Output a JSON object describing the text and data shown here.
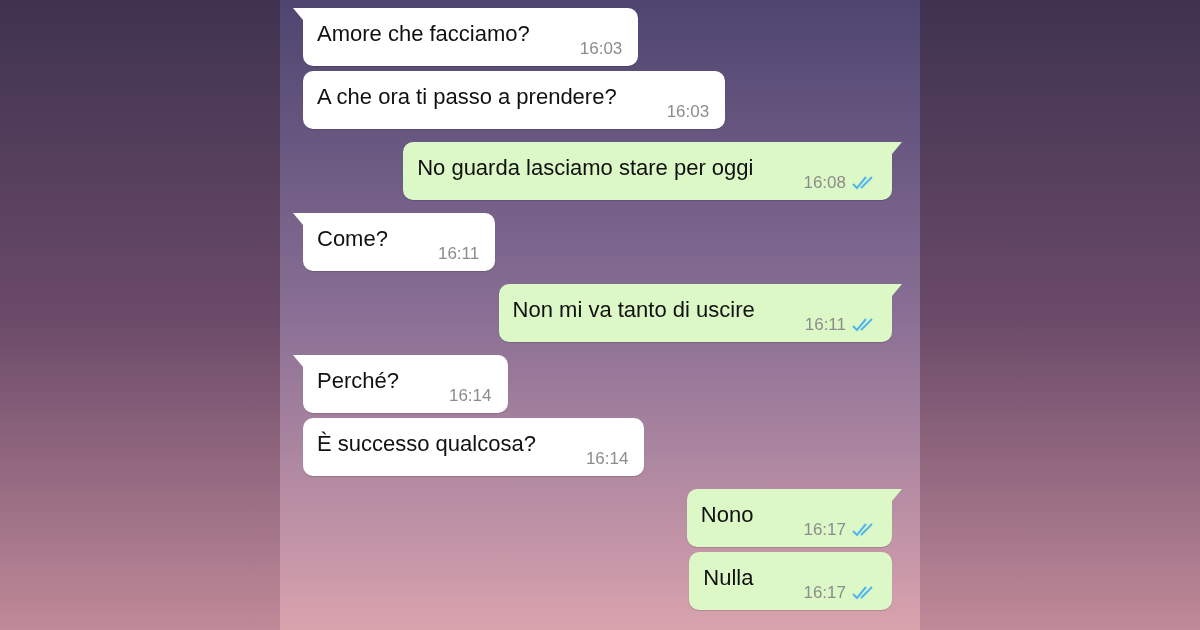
{
  "messages": [
    {
      "kind": "incoming",
      "tail": true,
      "text": "Amore che facciamo?",
      "time": "16:03"
    },
    {
      "kind": "incoming",
      "tail": false,
      "text": "A che ora ti passo a prendere?",
      "time": "16:03"
    },
    {
      "kind": "outgoing",
      "tail": true,
      "text": "No guarda lasciamo stare per oggi",
      "time": "16:08",
      "read": true
    },
    {
      "kind": "incoming",
      "tail": true,
      "text": "Come?",
      "time": "16:11"
    },
    {
      "kind": "outgoing",
      "tail": true,
      "text": "Non mi va tanto di uscire",
      "time": "16:11",
      "read": true
    },
    {
      "kind": "incoming",
      "tail": true,
      "text": "Perché?",
      "time": "16:14"
    },
    {
      "kind": "incoming",
      "tail": false,
      "text": "È successo qualcosa?",
      "time": "16:14"
    },
    {
      "kind": "outgoing",
      "tail": true,
      "text": "Nono",
      "time": "16:17",
      "read": true
    },
    {
      "kind": "outgoing",
      "tail": false,
      "text": "Nulla",
      "time": "16:17",
      "read": true
    }
  ]
}
